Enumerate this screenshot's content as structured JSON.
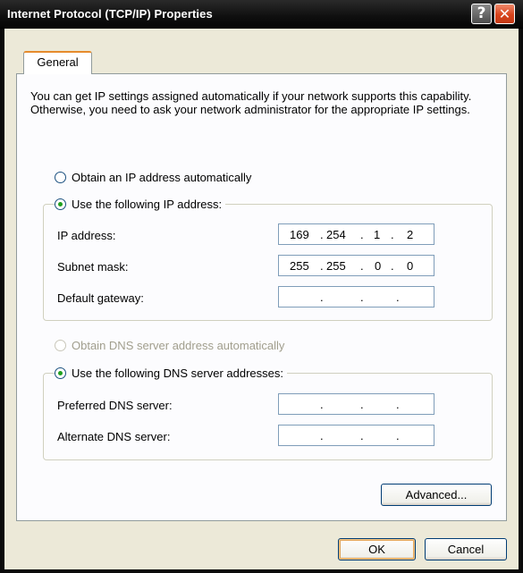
{
  "window": {
    "title": "Internet Protocol (TCP/IP) Properties",
    "help_label": "?",
    "close_label": "✕"
  },
  "tabs": [
    {
      "label": "General",
      "selected": true
    }
  ],
  "intro_text": "You can get IP settings assigned automatically if your network supports this capability. Otherwise, you need to ask your network administrator for the appropriate IP settings.",
  "ip_section": {
    "auto_label": "Obtain an IP address automatically",
    "auto_selected": false,
    "manual_label": "Use the following IP address:",
    "manual_selected": true,
    "fields": [
      {
        "label": "IP address:",
        "octets": [
          "169",
          "254",
          "1",
          "2"
        ]
      },
      {
        "label": "Subnet mask:",
        "octets": [
          "255",
          "255",
          "0",
          "0"
        ]
      },
      {
        "label": "Default gateway:",
        "octets": [
          "",
          "",
          "",
          ""
        ]
      }
    ]
  },
  "dns_section": {
    "auto_label": "Obtain DNS server address automatically",
    "auto_enabled": false,
    "manual_label": "Use the following DNS server addresses:",
    "manual_selected": true,
    "fields": [
      {
        "label": "Preferred DNS server:",
        "octets": [
          "",
          "",
          "",
          ""
        ]
      },
      {
        "label": "Alternate DNS server:",
        "octets": [
          "",
          "",
          "",
          ""
        ]
      }
    ]
  },
  "buttons": {
    "advanced": "Advanced...",
    "ok": "OK",
    "cancel": "Cancel"
  },
  "colors": {
    "title_bar": "#0f0f0f",
    "dialog_face": "#ece9d8",
    "radio_dot": "#21a121",
    "close_button": "#d8431c",
    "tab_highlight": "#e68b2c"
  }
}
